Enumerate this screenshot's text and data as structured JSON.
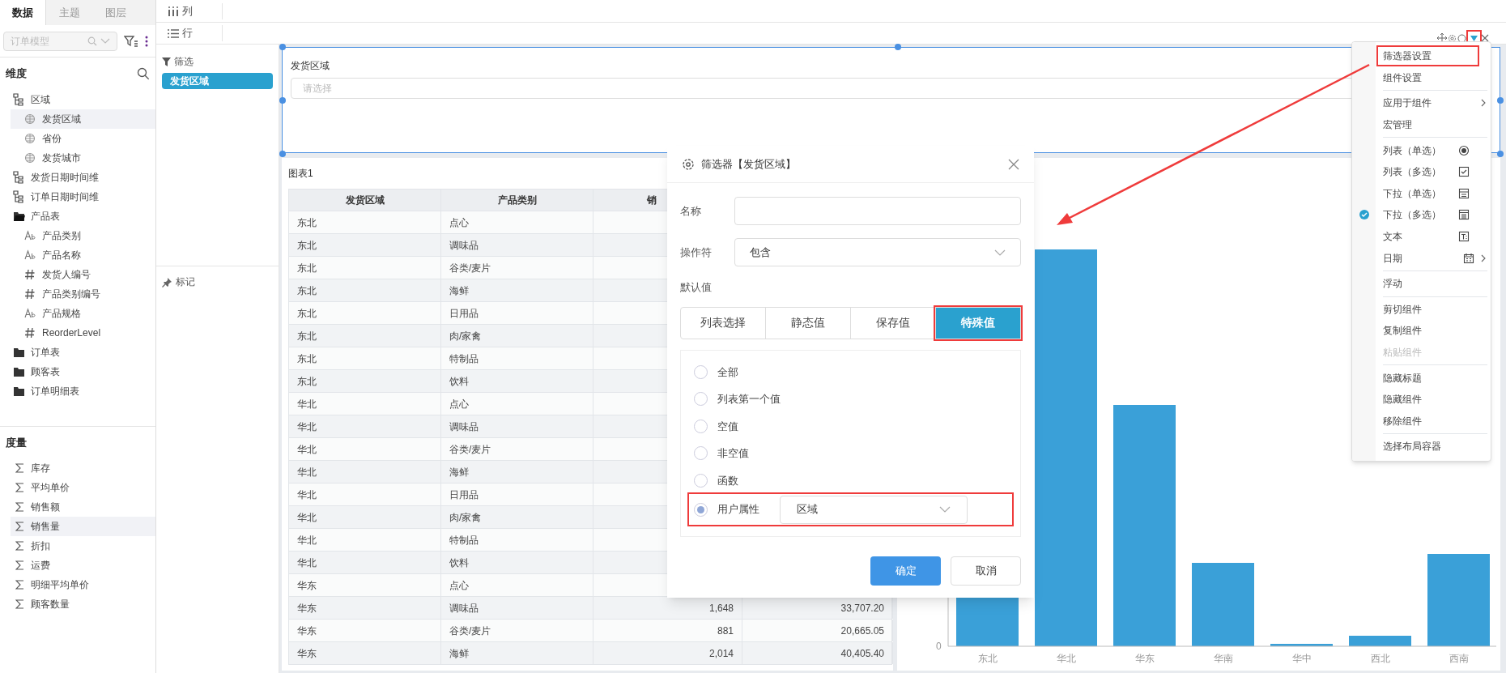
{
  "left_tabs": [
    {
      "label": "数据",
      "selected": true
    },
    {
      "label": "主题",
      "selected": false
    },
    {
      "label": "图层",
      "selected": false
    }
  ],
  "model_select": {
    "placeholder": "订单模型"
  },
  "dimensions": {
    "title": "维度",
    "items": [
      {
        "label": "区域",
        "kind": "hierarchy",
        "selected": false,
        "children": [
          {
            "label": "发货区域",
            "kind": "geo",
            "selected": true
          },
          {
            "label": "省份",
            "kind": "geo",
            "selected": false
          },
          {
            "label": "发货城市",
            "kind": "geo",
            "selected": false
          }
        ]
      },
      {
        "label": "发货日期时间维",
        "kind": "hierarchy",
        "selected": false
      },
      {
        "label": "订单日期时间维",
        "kind": "hierarchy",
        "selected": false
      },
      {
        "label": "产品表",
        "kind": "table",
        "selected": false,
        "children": [
          {
            "label": "产品类别",
            "kind": "text",
            "selected": false
          },
          {
            "label": "产品名称",
            "kind": "text",
            "selected": false
          },
          {
            "label": "发货人编号",
            "kind": "number",
            "selected": false
          },
          {
            "label": "产品类别编号",
            "kind": "number",
            "selected": false
          },
          {
            "label": "产品规格",
            "kind": "text",
            "selected": false
          },
          {
            "label": "ReorderLevel",
            "kind": "number",
            "selected": false
          }
        ]
      },
      {
        "label": "订单表",
        "kind": "folder",
        "selected": false
      },
      {
        "label": "顾客表",
        "kind": "folder",
        "selected": false
      },
      {
        "label": "订单明细表",
        "kind": "folder",
        "selected": false
      }
    ]
  },
  "measures": {
    "title": "度量",
    "items": [
      {
        "label": "库存",
        "selected": false
      },
      {
        "label": "平均单价",
        "selected": false
      },
      {
        "label": "销售额",
        "selected": false
      },
      {
        "label": "销售量",
        "selected": true
      },
      {
        "label": "折扣",
        "selected": false
      },
      {
        "label": "运费",
        "selected": false
      },
      {
        "label": "明细平均单价",
        "selected": false
      },
      {
        "label": "顾客数量",
        "selected": false
      }
    ]
  },
  "shelves": {
    "columns": "列",
    "rows": "行"
  },
  "filter_panel": {
    "title": "筛选",
    "chips": [
      "发货区域"
    ],
    "marks_title": "标记"
  },
  "filter_component": {
    "label": "发货区域",
    "placeholder": "请选择"
  },
  "table": {
    "title": "图表1",
    "columns": [
      "发货区域",
      "产品类别",
      "销"
    ],
    "rows": [
      [
        "东北",
        "点心"
      ],
      [
        "东北",
        "调味品"
      ],
      [
        "东北",
        "谷类/麦片"
      ],
      [
        "东北",
        "海鲜"
      ],
      [
        "东北",
        "日用品"
      ],
      [
        "东北",
        "肉/家禽"
      ],
      [
        "东北",
        "特制品"
      ],
      [
        "东北",
        "饮料"
      ],
      [
        "华北",
        "点心"
      ],
      [
        "华北",
        "调味品"
      ],
      [
        "华北",
        "谷类/麦片"
      ],
      [
        "华北",
        "海鲜"
      ],
      [
        "华北",
        "日用品"
      ],
      [
        "华北",
        "肉/家禽"
      ],
      [
        "华北",
        "特制品"
      ],
      [
        "华北",
        "饮料"
      ],
      [
        "华东",
        "点心"
      ],
      [
        "华东",
        "调味品",
        "1,648",
        "33,707.20"
      ],
      [
        "华东",
        "谷类/麦片",
        "881",
        "20,665.05"
      ],
      [
        "华东",
        "海鲜",
        "2,014",
        "40,405.40"
      ]
    ]
  },
  "chart": {
    "zero_label": "0",
    "categories": [
      "东北",
      "华北",
      "华东",
      "华南",
      "华中",
      "西北",
      "西南"
    ]
  },
  "dialog": {
    "title": "筛选器【发货区域】",
    "name_label": "名称",
    "operator_label": "操作符",
    "operator_value": "包含",
    "default_label": "默认值",
    "tabs": [
      {
        "label": "列表选择",
        "selected": false,
        "highlighted": false
      },
      {
        "label": "静态值",
        "selected": false,
        "highlighted": false
      },
      {
        "label": "保存值",
        "selected": false,
        "highlighted": false
      },
      {
        "label": "特殊值",
        "selected": true,
        "highlighted": true
      }
    ],
    "options": [
      {
        "label": "全部",
        "selected": false,
        "highlighted": false
      },
      {
        "label": "列表第一个值",
        "selected": false,
        "highlighted": false
      },
      {
        "label": "空值",
        "selected": false,
        "highlighted": false
      },
      {
        "label": "非空值",
        "selected": false,
        "highlighted": false
      },
      {
        "label": "函数",
        "selected": false,
        "highlighted": false
      },
      {
        "label": "用户属性",
        "selected": true,
        "highlighted": true,
        "select_value": "区域"
      }
    ],
    "ok": "确定",
    "cancel": "取消"
  },
  "component_toolbar": {
    "dropdown_highlighted": true
  },
  "context_menu": {
    "groups": [
      [
        {
          "label": "筛选器设置",
          "highlighted": true
        },
        {
          "label": "组件设置"
        }
      ],
      [
        {
          "label": "应用于组件",
          "submenu": true
        },
        {
          "label": "宏管理"
        }
      ],
      [
        {
          "label": "列表（单选）",
          "kind": "radio",
          "checked": false
        },
        {
          "label": "列表（多选）",
          "kind": "checkbox",
          "checked": false
        },
        {
          "label": "下拉（单选）",
          "kind": "dropdown-single",
          "checked": false
        },
        {
          "label": "下拉（多选）",
          "kind": "dropdown-multi",
          "checked": true
        },
        {
          "label": "文本",
          "kind": "text",
          "checked": false
        },
        {
          "label": "日期",
          "kind": "calendar",
          "checked": false,
          "submenu": true
        }
      ],
      [
        {
          "label": "浮动"
        }
      ],
      [
        {
          "label": "剪切组件"
        },
        {
          "label": "复制组件"
        },
        {
          "label": "粘贴组件",
          "disabled": true
        }
      ],
      [
        {
          "label": "隐藏标题"
        },
        {
          "label": "隐藏组件"
        },
        {
          "label": "移除组件"
        }
      ],
      [
        {
          "label": "选择布局容器"
        }
      ]
    ]
  }
}
